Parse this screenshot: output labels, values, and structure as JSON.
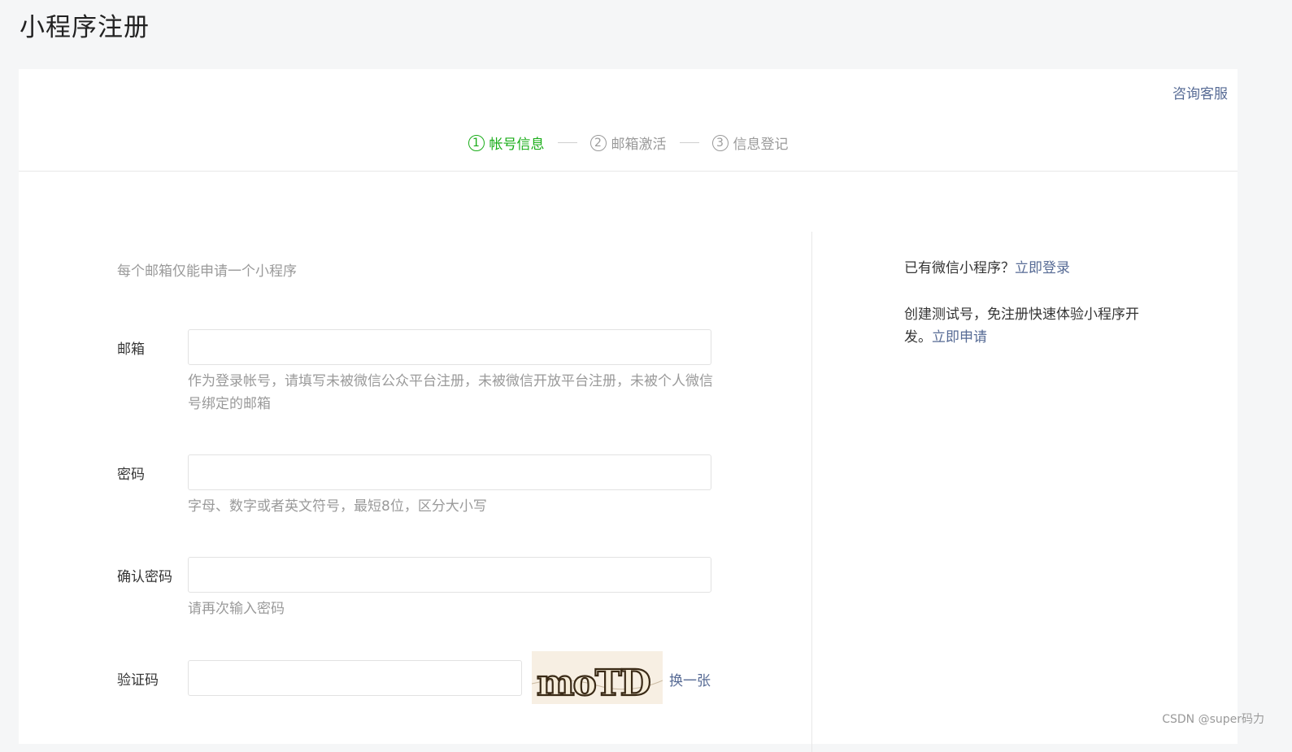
{
  "page": {
    "title": "小程序注册"
  },
  "header": {
    "help_link": "咨询客服"
  },
  "steps": [
    {
      "num": "1",
      "label": "帐号信息",
      "active": true
    },
    {
      "num": "2",
      "label": "邮箱激活",
      "active": false
    },
    {
      "num": "3",
      "label": "信息登记",
      "active": false
    }
  ],
  "form": {
    "intro": "每个邮箱仅能申请一个小程序",
    "email": {
      "label": "邮箱",
      "value": "",
      "hint": "作为登录帐号，请填写未被微信公众平台注册，未被微信开放平台注册，未被个人微信号绑定的邮箱"
    },
    "password": {
      "label": "密码",
      "value": "",
      "hint": "字母、数字或者英文符号，最短8位，区分大小写"
    },
    "confirm": {
      "label": "确认密码",
      "value": "",
      "hint": "请再次输入密码"
    },
    "captcha": {
      "label": "验证码",
      "value": "",
      "image_text": "moTD",
      "refresh": "换一张"
    }
  },
  "side": {
    "login_prompt": "已有微信小程序？",
    "login_link": "立即登录",
    "test_prompt": "创建测试号，免注册快速体验小程序开发。",
    "test_link": "立即申请"
  },
  "watermark": "CSDN @super码力",
  "colors": {
    "accent": "#1aad19",
    "link": "#576b95",
    "muted": "#9a9a9a"
  }
}
